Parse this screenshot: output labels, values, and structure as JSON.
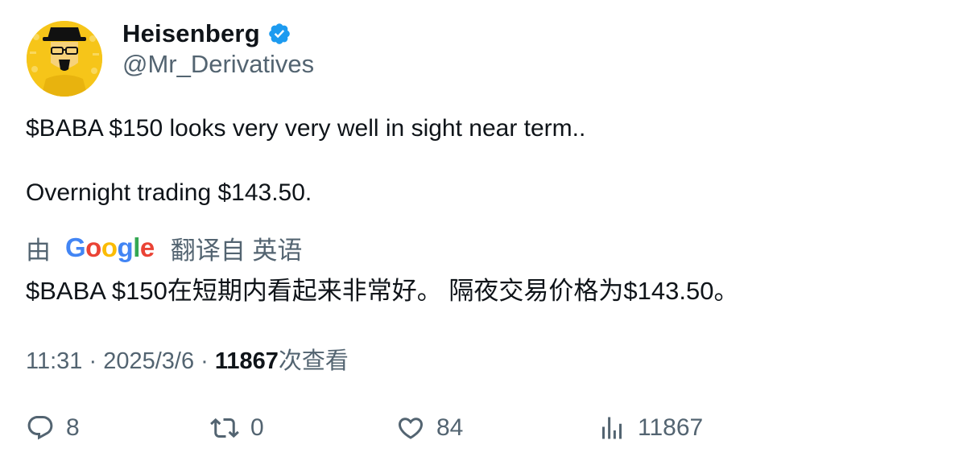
{
  "author": {
    "display_name": "Heisenberg",
    "handle": "@Mr_Derivatives",
    "verified_icon": "verified-badge-icon",
    "avatar_bg": "#f6c519"
  },
  "tweet": {
    "line1": "$BABA $150 looks very very well in sight near term..",
    "line2": "Overnight trading $143.50."
  },
  "translation": {
    "prefix": "由",
    "logo": {
      "letters": [
        "G",
        "o",
        "o",
        "g",
        "l",
        "e"
      ]
    },
    "suffix": "翻译自 英语",
    "text": "$BABA $150在短期内看起来非常好。 隔夜交易价格为$143.50。"
  },
  "meta": {
    "time": "11:31",
    "separator": " · ",
    "date": "2025/3/6",
    "views_count": "11867",
    "views_label": "次查看"
  },
  "actions": {
    "replies": "8",
    "retweets": "0",
    "likes": "84",
    "views": "11867"
  },
  "colors": {
    "text_primary": "#0f1419",
    "text_secondary": "#536471",
    "verified_blue": "#1d9bf0"
  }
}
